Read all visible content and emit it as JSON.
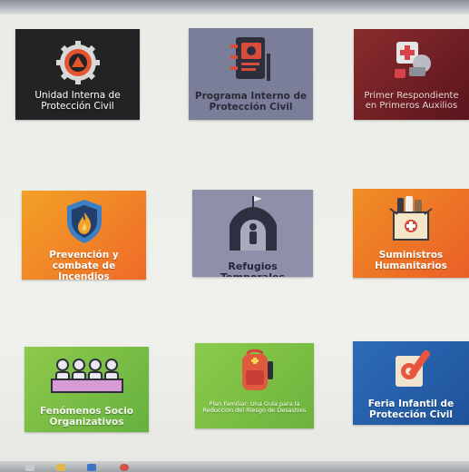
{
  "tiles": [
    {
      "id": "unidad-interna",
      "label": "Unidad Interna de Protección Civil",
      "bg": "#222325",
      "icon": "gear-warning-icon"
    },
    {
      "id": "programa-interno",
      "label": "Programa Interno de Protección Civil",
      "bg": "#7b7e99",
      "icon": "notebook-icon"
    },
    {
      "id": "primer-respondiente",
      "label": "Primer Respondiente en Primeros Auxilios",
      "bg": "#6e1b22",
      "icon": "first-aid-icon"
    },
    {
      "id": "prevencion-incendios",
      "label": "Prevención y combate de Incendios",
      "bg": "#f08a24",
      "icon": "fire-shield-icon"
    },
    {
      "id": "refugios-temporales",
      "label": "Refugios Temporales",
      "bg": "#8e90a9",
      "icon": "shelter-icon"
    },
    {
      "id": "suministros",
      "label": "Suministros Humanitarios",
      "bg": "#ef7a26",
      "icon": "supplies-box-icon"
    },
    {
      "id": "fenomenos",
      "label": "Fenómenos Socio Organizativos",
      "bg": "#78bd45",
      "icon": "crowd-icon"
    },
    {
      "id": "plan-familiar",
      "label": "Plan Familiar: Una Guía para la Reducción del Riesgo de Desastres",
      "bg": "#7fc047",
      "icon": "backpack-icon"
    },
    {
      "id": "feria-infantil",
      "label": "Feria Infantil de Protección Civil",
      "bg": "#2760a8",
      "icon": "pencil-card-icon"
    }
  ]
}
